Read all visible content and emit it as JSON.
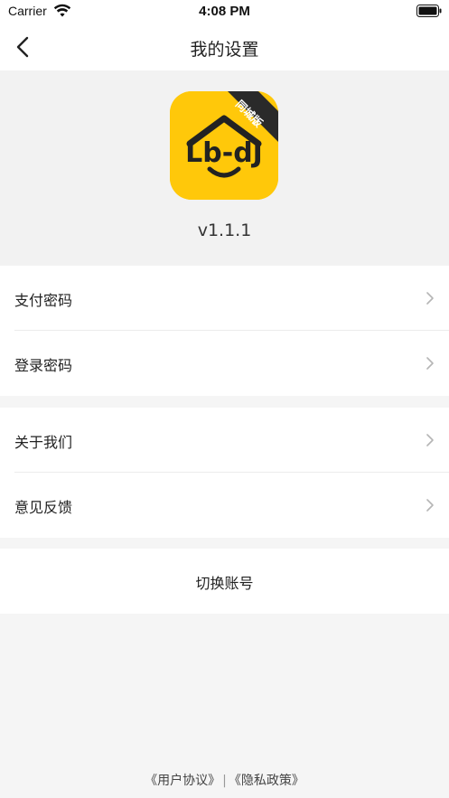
{
  "status_bar": {
    "carrier": "Carrier",
    "time": "4:08 PM"
  },
  "nav": {
    "title": "我的设置"
  },
  "app": {
    "badge": "同城版",
    "logo_text": "Lb-dJ",
    "version": "v1.1.1",
    "brand_color": "#ffc80a"
  },
  "settings": {
    "group1": [
      {
        "label": "支付密码"
      },
      {
        "label": "登录密码"
      }
    ],
    "group2": [
      {
        "label": "关于我们"
      },
      {
        "label": "意见反馈"
      }
    ],
    "switch_account": "切换账号"
  },
  "footer": {
    "user_agreement": "《用户协议》",
    "separator": "|",
    "privacy_policy": "《隐私政策》"
  },
  "icons": [
    "wifi-icon",
    "battery-icon",
    "back-icon",
    "chevron-right-icon"
  ]
}
